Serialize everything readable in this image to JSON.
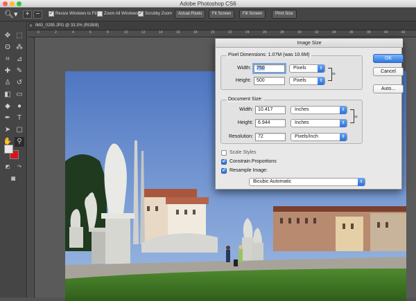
{
  "app": {
    "title": "Adobe Photoshop CS6"
  },
  "options_bar": {
    "zoom_in_symbol": "+",
    "zoom_out_symbol": "−",
    "resize_windows_label": "Resize Windows to Fit",
    "zoom_all_label": "Zoom All Windows",
    "scrubby_zoom_label": "Scrubby Zoom",
    "actual_pixels_label": "Actual Pixels",
    "fit_screen_label": "Fit Screen",
    "fill_screen_label": "Fill Screen",
    "print_size_label": "Print Size",
    "resize_windows_checked": true,
    "zoom_all_checked": false,
    "scrubby_zoom_checked": true
  },
  "document": {
    "tab_title": "IMG_0295.JPG @ 33.3% (RGB/8)",
    "ruler_ticks": [
      "0",
      "2",
      "4",
      "6",
      "8",
      "10",
      "12",
      "14",
      "16",
      "18",
      "20",
      "22",
      "24",
      "26",
      "28",
      "30",
      "32",
      "34",
      "36",
      "38",
      "40",
      "42"
    ]
  },
  "dialog": {
    "title": "Image Size",
    "pixel_dimensions_label": "Pixel Dimensions:",
    "pixel_dimensions_value": "1.07M (was 10.6M)",
    "width_label": "Width:",
    "width_value": "750",
    "width_unit": "Pixels",
    "height_label": "Height:",
    "height_value": "500",
    "height_unit": "Pixels",
    "document_size_label": "Document Size:",
    "doc_width_label": "Width:",
    "doc_width_value": "10.417",
    "doc_width_unit": "Inches",
    "doc_height_label": "Height:",
    "doc_height_value": "6.944",
    "doc_height_unit": "Inches",
    "resolution_label": "Resolution:",
    "resolution_value": "72",
    "resolution_unit": "Pixels/Inch",
    "scale_styles_label": "Scale Styles",
    "scale_styles_checked": false,
    "constrain_label": "Constrain Proportions",
    "constrain_checked": true,
    "resample_label": "Resample Image:",
    "resample_checked": true,
    "resample_method": "Bicubic Automatic",
    "ok_label": "OK",
    "cancel_label": "Cancel",
    "auto_label": "Auto..."
  },
  "colors": {
    "foreground": "#e8e8e8",
    "background": "#d4151a",
    "accent": "#2e79e3"
  }
}
